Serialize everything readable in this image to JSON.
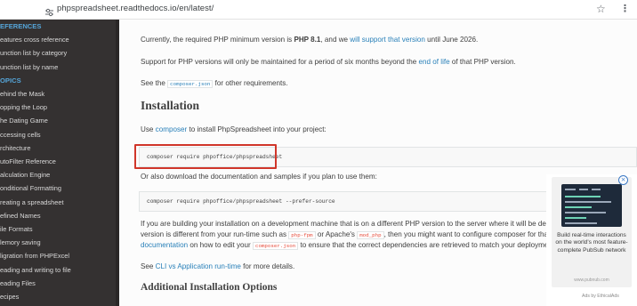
{
  "browser": {
    "url": "phpspreadsheet.readthedocs.io/en/latest/",
    "site_info_icon": "tune-icon",
    "bookmark_icon": "star-icon",
    "menu_icon": "more-icon"
  },
  "sidebar": {
    "items": [
      {
        "label": "EFERENCES",
        "type": "caption"
      },
      {
        "label": "eatures cross reference",
        "type": "link"
      },
      {
        "label": "unction list by category",
        "type": "link"
      },
      {
        "label": "unction list by name",
        "type": "link"
      },
      {
        "label": "OPICS",
        "type": "caption"
      },
      {
        "label": "ehind the Mask",
        "type": "link"
      },
      {
        "label": "opping the Loop",
        "type": "link"
      },
      {
        "label": "he Dating Game",
        "type": "link"
      },
      {
        "label": "ccessing cells",
        "type": "link"
      },
      {
        "label": "rchitecture",
        "type": "link"
      },
      {
        "label": "utoFilter Reference",
        "type": "link"
      },
      {
        "label": "alculation Engine",
        "type": "link"
      },
      {
        "label": "onditional Formatting",
        "type": "link"
      },
      {
        "label": "reating a spreadsheet",
        "type": "link"
      },
      {
        "label": "efined Names",
        "type": "link"
      },
      {
        "label": "ile Formats",
        "type": "link"
      },
      {
        "label": "lemory saving",
        "type": "link"
      },
      {
        "label": "ligration from PHPExcel",
        "type": "link"
      },
      {
        "label": "eading and writing to file",
        "type": "link"
      },
      {
        "label": "eading Files",
        "type": "link"
      },
      {
        "label": "ecipes",
        "type": "link"
      }
    ]
  },
  "content": {
    "para_required": {
      "pre": "Currently, the required PHP minimum version is ",
      "version": "PHP 8.1",
      "mid": ", and we ",
      "link": "will support that version",
      "post": " until June 2026."
    },
    "para_support": {
      "pre": "Support for PHP versions will only be maintained for a period of six months beyond the ",
      "link": "end of life",
      "post": " of that PHP version."
    },
    "para_see": {
      "pre": "See the ",
      "code": "composer.json",
      "post": " for other requirements."
    },
    "heading_installation": "Installation",
    "para_use": {
      "pre": "Use ",
      "link": "composer",
      "post": " to install PhpSpreadsheet into your project:"
    },
    "code_require": "composer require phpoffice/phpspreadsheet",
    "para_download": "Or also download the documentation and samples if you plan to use them:",
    "code_source": "composer require phpoffice/phpspreadsheet --prefer-source",
    "para_dev1": "If you are building your installation on a development machine that is on a different PHP version to the server where it will be deployed, o",
    "para_dev2": {
      "pre": "version is different from your run-time such as ",
      "code1": "php-fpm",
      "mid": " or Apache's ",
      "code2": "mod_php",
      "post": ", then you might want to configure composer for that. See co"
    },
    "para_dev3": {
      "link": "documentation",
      "pre": " on how to edit your ",
      "code": "composer.json",
      "post": " to ensure that the correct dependencies are retrieved to match your deployment envir"
    },
    "para_cli": {
      "pre": "See ",
      "link": "CLI vs Application run-time",
      "post": " for more details."
    },
    "heading_additional": "Additional Installation Options"
  },
  "ad": {
    "text": "Build real-time interactions on the world's most feature-complete PubSub network",
    "domain": "www.pubnub.com",
    "by": "Ads by EthicalAds",
    "close_icon": "close-icon"
  },
  "colors": {
    "sidebar_bg": "#343131",
    "caption": "#55a5d9",
    "link": "#2980b9",
    "highlight_box": "#d0362a",
    "inline_code": "#e74c3c"
  }
}
